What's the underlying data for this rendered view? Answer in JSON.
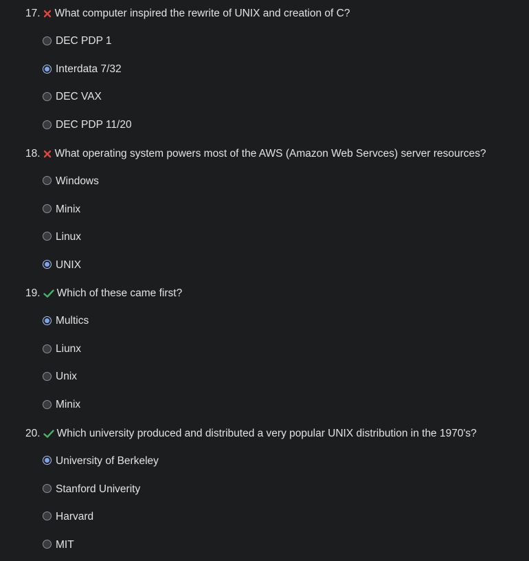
{
  "colors": {
    "background": "#1c1d1f",
    "text": "#e2e3e5",
    "wrong_mark": "#e0453d",
    "correct_mark": "#45b56a",
    "radio_selected": "#7ea3ea"
  },
  "questions": [
    {
      "number": "17.",
      "status": "wrong",
      "status_icon": "x-mark-icon",
      "text": "What computer inspired the rewrite of UNIX and creation of C?",
      "options": [
        {
          "label": "DEC PDP 1",
          "selected": false
        },
        {
          "label": "Interdata 7/32",
          "selected": true
        },
        {
          "label": "DEC VAX",
          "selected": false
        },
        {
          "label": "DEC PDP 11/20",
          "selected": false
        }
      ]
    },
    {
      "number": "18.",
      "status": "wrong",
      "status_icon": "x-mark-icon",
      "text": "What operating system powers most of the AWS (Amazon Web Servces) server resources?",
      "options": [
        {
          "label": "Windows",
          "selected": false
        },
        {
          "label": "Minix",
          "selected": false
        },
        {
          "label": "Linux",
          "selected": false
        },
        {
          "label": "UNIX",
          "selected": true
        }
      ]
    },
    {
      "number": "19.",
      "status": "correct",
      "status_icon": "check-mark-icon",
      "text": "Which of these came first?",
      "options": [
        {
          "label": "Multics",
          "selected": true
        },
        {
          "label": "Liunx",
          "selected": false
        },
        {
          "label": "Unix",
          "selected": false
        },
        {
          "label": "Minix",
          "selected": false
        }
      ]
    },
    {
      "number": "20.",
      "status": "correct",
      "status_icon": "check-mark-icon",
      "text": "Which university produced and distributed a very popular UNIX distribution in the 1970's?",
      "options": [
        {
          "label": "University of Berkeley",
          "selected": true
        },
        {
          "label": "Stanford Univerity",
          "selected": false
        },
        {
          "label": "Harvard",
          "selected": false
        },
        {
          "label": "MIT",
          "selected": false
        }
      ]
    }
  ]
}
